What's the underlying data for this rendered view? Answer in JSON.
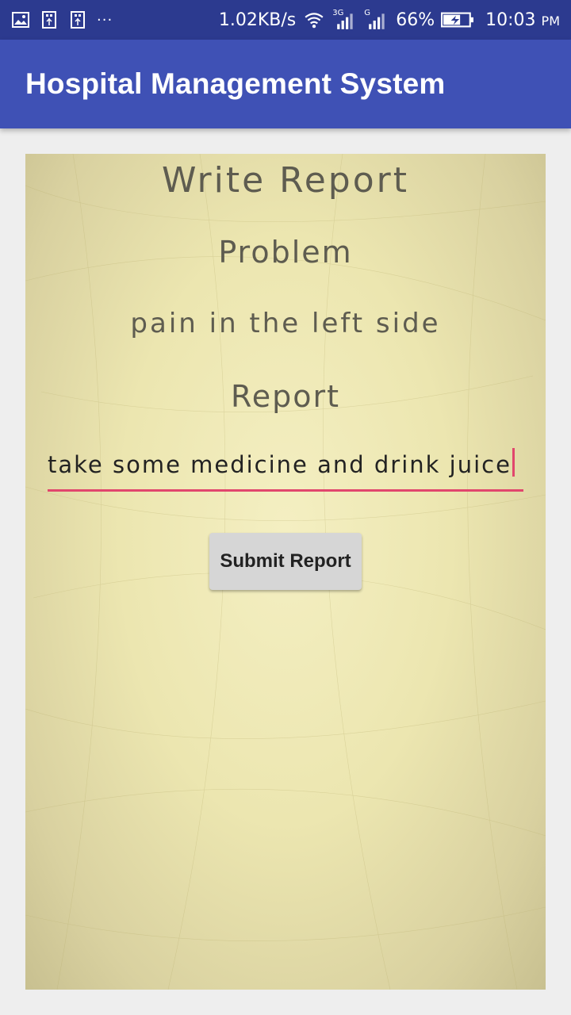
{
  "status_bar": {
    "net_speed": "1.02KB/s",
    "battery": "66%",
    "time": "10:03",
    "ampm": "PM",
    "overflow": "···",
    "net_3g": "3G",
    "net_g": "G"
  },
  "app_bar": {
    "title": "Hospital Management System"
  },
  "form": {
    "heading": "Write Report",
    "problem_label": "Problem",
    "problem_text": "pain in the left side",
    "report_label": "Report",
    "report_value": "take some medicine and drink juice",
    "submit_label": "Submit Report"
  },
  "colors": {
    "status_bar": "#2c3a8f",
    "app_bar": "#3f51b5",
    "accent": "#e1466d",
    "paper": "#ece6b0"
  }
}
